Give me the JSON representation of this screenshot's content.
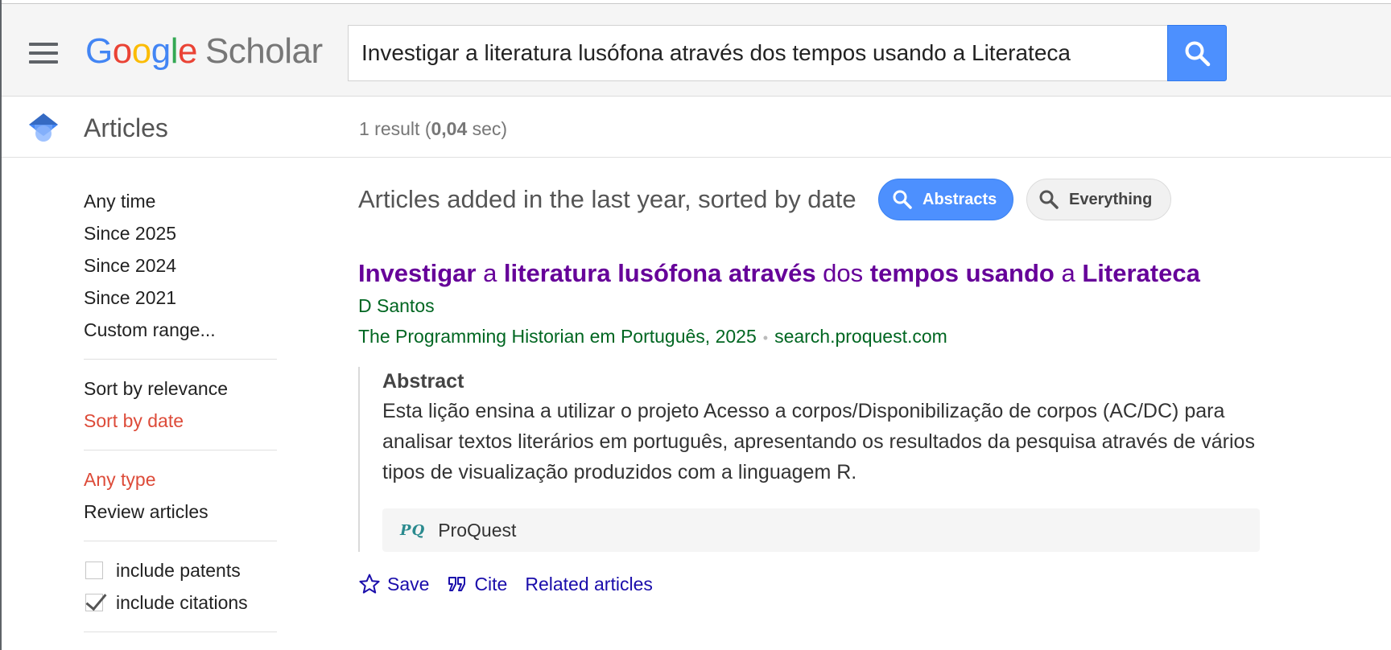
{
  "header": {
    "logo": {
      "g": "G",
      "o1": "o",
      "o2": "o",
      "g2": "g",
      "l": "l",
      "e": "e",
      "scholar": "Scholar"
    },
    "search_query": "Investigar a literatura lusófona através dos tempos usando a Literateca"
  },
  "subheader": {
    "title": "Articles",
    "result_count_prefix": "1 result (",
    "result_time": "0,04",
    "result_count_suffix": " sec)"
  },
  "sidebar": {
    "time_filters": [
      "Any time",
      "Since 2025",
      "Since 2024",
      "Since 2021",
      "Custom range..."
    ],
    "sort_options": [
      "Sort by relevance",
      "Sort by date"
    ],
    "type_options": [
      "Any type",
      "Review articles"
    ],
    "include_patents": "include patents",
    "include_citations": "include citations"
  },
  "main": {
    "filter_text": "Articles added in the last year, sorted by date",
    "chip_abstracts": "Abstracts",
    "chip_everything": "Everything"
  },
  "result": {
    "title_parts": [
      "Investigar",
      " a ",
      "literatura lusófona através",
      " dos ",
      "tempos usando",
      " a ",
      "Literateca"
    ],
    "author": "D Santos",
    "source": "The Programming Historian em Português, 2025",
    "source_dot": "•",
    "domain": "search.proquest.com",
    "abstract_heading": "Abstract",
    "abstract_text": "Esta lição ensina a utilizar o projeto Acesso a corpos/Disponibilização de corpos (AC/DC) para analisar textos literários em português, apresentando os resultados da pesquisa através de vários tipos de visualização produzidos com a linguagem R.",
    "provider_icon": "PQ",
    "provider_name": "ProQuest",
    "actions": {
      "save": "Save",
      "cite": "Cite",
      "related": "Related articles"
    }
  },
  "colors": {
    "accent_blue": "#4d90fe",
    "title_purple": "#660099",
    "green": "#006621",
    "active_red": "#dd4b39",
    "link_blue": "#1a0dab"
  }
}
